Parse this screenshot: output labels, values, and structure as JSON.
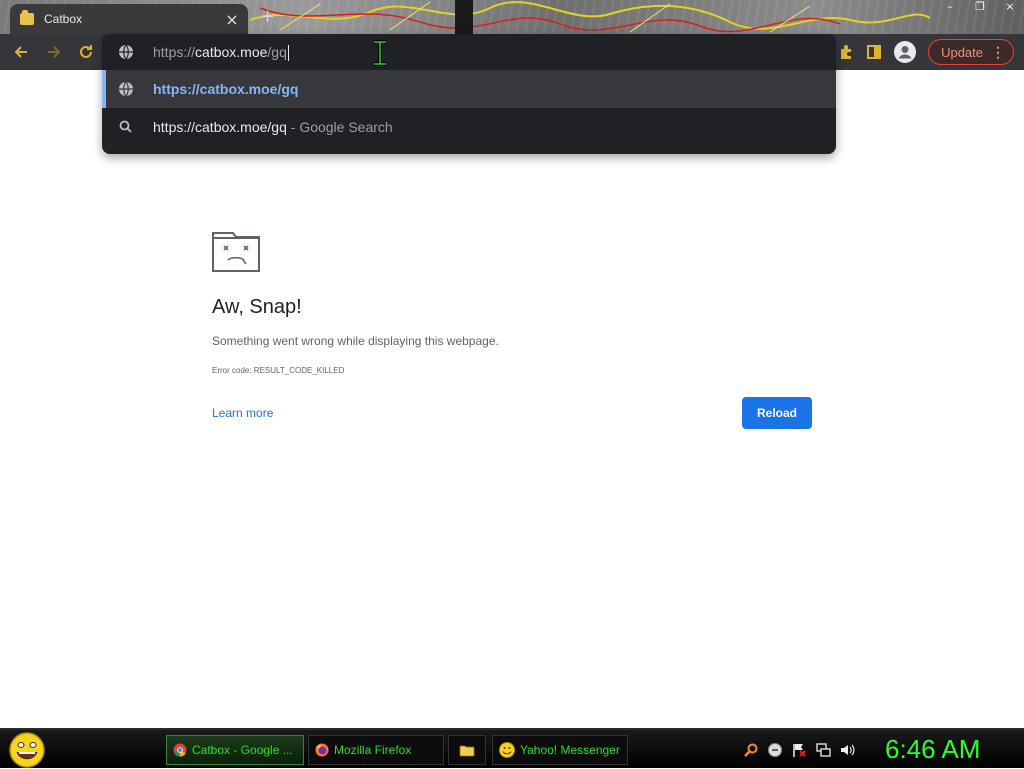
{
  "browser": {
    "tab": {
      "title": "Catbox",
      "close_glyph": "×"
    },
    "new_tab_glyph": "+",
    "window_buttons": [
      "–",
      "❐",
      "×"
    ],
    "update_label": "Update"
  },
  "omnibox": {
    "scheme": "https://",
    "host": "catbox.moe",
    "path": "/gq",
    "suggestions": [
      {
        "icon": "globe-icon",
        "text": "https://catbox.moe/gq"
      },
      {
        "icon": "search-icon",
        "text": "https://catbox.moe/gq",
        "separator": " - ",
        "suffix": "Google Search"
      }
    ]
  },
  "error_page": {
    "title": "Aw, Snap!",
    "message": "Something went wrong while displaying this webpage.",
    "error_code": "Error code: RESULT_CODE_KILLED",
    "learn_more": "Learn more",
    "reload": "Reload"
  },
  "taskbar": {
    "items": [
      {
        "label": "Catbox - Google ...",
        "icon": "chrome-icon",
        "active": true
      },
      {
        "label": "Mozilla Firefox",
        "icon": "firefox-icon",
        "active": false
      },
      {
        "label": "",
        "icon": "folder-icon",
        "active": false
      },
      {
        "label": "Yahoo! Messenger",
        "icon": "yahoo-messenger-icon",
        "active": false
      }
    ],
    "clock": "6:46 AM"
  },
  "colors": {
    "accent_blue": "#1a73e8",
    "taskbar_text": "#21e221",
    "clock": "#2bff2b",
    "update_red": "#ea4335"
  }
}
